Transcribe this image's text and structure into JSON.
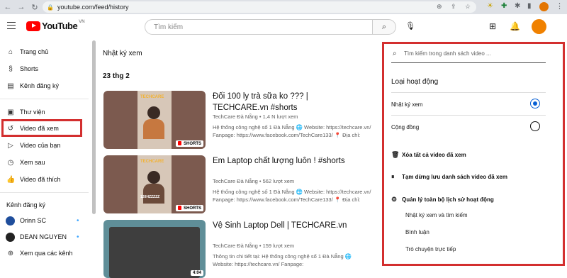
{
  "browser": {
    "url": "youtube.com/feed/history",
    "back_icon": "←",
    "forward_icon": "→",
    "reload_icon": "↻"
  },
  "header": {
    "logo_text": "YouTube",
    "logo_region": "VN",
    "search_placeholder": "Tìm kiếm"
  },
  "sidebar": {
    "items": [
      {
        "label": "Trang chủ",
        "icon": "⌂"
      },
      {
        "label": "Shorts",
        "icon": "§"
      },
      {
        "label": "Kênh đăng ký",
        "icon": "▤"
      },
      {
        "label": "Thư viện",
        "icon": "▣"
      },
      {
        "label": "Video đã xem",
        "icon": "↺"
      },
      {
        "label": "Video của bạn",
        "icon": "▷"
      },
      {
        "label": "Xem sau",
        "icon": "◷"
      },
      {
        "label": "Video đã thích",
        "icon": "👍"
      }
    ],
    "subscriptions_title": "Kênh đăng ký",
    "channels": [
      {
        "label": "Orinn SC",
        "color": "#1f4e9c"
      },
      {
        "label": "DEAN NGUYEN",
        "color": "#222222"
      }
    ],
    "browse_channels": "Xem qua các kênh"
  },
  "main": {
    "page_title": "Nhật ký xem",
    "date_label": "23 thg 2",
    "videos": [
      {
        "title": "Đối 100 ly trà sữa ko ??? | TECHCARE.vn #shorts",
        "channel": "TechCare Đà Nẵng",
        "views": "1,4 N lượt xem",
        "desc": "Hệ thống công nghệ số 1 Đà Nẵng 🌐 Website: https://techcare.vn/ Fanpage: https://www.facebook.com/TechCare133/ 📍 Địa chỉ:",
        "badge": "SHORTS",
        "brand": "TECHCARE"
      },
      {
        "title": "Em Laptop chất lượng luôn ! #shorts",
        "channel": "TechCare Đà Nẵng",
        "views": "562 lượt xem",
        "desc": "Hệ thống công nghệ số 1 Đà Nẵng 🌐 Website: https://techcare.vn/ Fanpage: https://www.facebook.com/TechCare133/ 📍 Địa chỉ:",
        "badge": "SHORTS",
        "brand": "TECHCARE",
        "overlay": "120HZZZZZ"
      },
      {
        "title": "Vệ Sinh Laptop Dell | TECHCARE.vn",
        "channel": "TechCare Đà Nẵng",
        "views": "159 lượt xem",
        "desc": "Thông tin chi tiết tại: Hệ thống công nghệ số 1 Đà Nẵng 🌐 Website: https://techcare.vn/ Fanpage:",
        "badge": "4:04"
      }
    ]
  },
  "panel": {
    "search_placeholder": "Tìm kiếm trong danh sách video ...",
    "activity_label": "Loại hoạt động",
    "options": [
      {
        "label": "Nhật ký xem",
        "selected": true
      },
      {
        "label": "Cộng đồng",
        "selected": false
      }
    ],
    "actions": [
      {
        "label": "Xóa tất cả video đã xem",
        "icon": "🗑"
      },
      {
        "label": "Tạm dừng lưu danh sách video đã xem",
        "icon": "⏸"
      },
      {
        "label": "Quản lý toàn bộ lịch sử hoạt động",
        "icon": "⚙"
      }
    ],
    "sub_links": [
      "Nhật ký xem và tìm kiếm",
      "Bình luận",
      "Trò chuyện trực tiếp"
    ]
  },
  "colors": {
    "highlight": "#d32f2f",
    "accent": "#065fd4",
    "brand_red": "#ff0000"
  }
}
